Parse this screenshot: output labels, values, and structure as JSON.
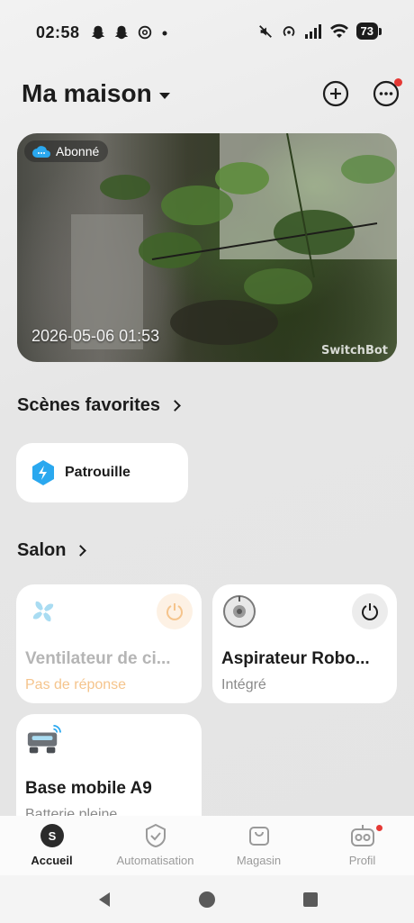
{
  "status_bar": {
    "time": "02:58",
    "battery": "73",
    "left_icons": [
      "snapchat-icon",
      "snapchat-icon",
      "threads-icon",
      "dot-icon"
    ],
    "right_icons": [
      "mute-icon",
      "hotspot-icon",
      "signal-icon",
      "wifi-icon",
      "battery-icon"
    ]
  },
  "header": {
    "title": "Ma maison"
  },
  "camera": {
    "badge": "Abonné",
    "timestamp": "2026-05-06 01:53",
    "watermark": "SwitchBot"
  },
  "favorites": {
    "title": "Scènes favorites",
    "scenes": [
      {
        "label": "Patrouille",
        "icon": "bolt-hexagon-icon"
      }
    ]
  },
  "room": {
    "title": "Salon",
    "devices": [
      {
        "name": "Ventilateur de ci...",
        "status": "Pas de réponse",
        "icon": "fan-icon",
        "has_power": true
      },
      {
        "name": "Aspirateur Robo...",
        "status": "Intégré",
        "icon": "robot-vacuum-icon",
        "has_power": true
      },
      {
        "name": "Base mobile A9",
        "status": "Batterie pleine",
        "icon": "mobile-base-icon",
        "has_power": false
      }
    ]
  },
  "tabs": [
    {
      "label": "Accueil",
      "active": true,
      "icon": "home-avatar-icon"
    },
    {
      "label": "Automatisation",
      "active": false,
      "icon": "shield-check-icon"
    },
    {
      "label": "Magasin",
      "active": false,
      "icon": "shopping-bag-icon"
    },
    {
      "label": "Profil",
      "active": false,
      "icon": "robot-face-icon"
    }
  ],
  "colors": {
    "accent_blue": "#2aa8ef",
    "offline_orange": "#f5c48c",
    "notification_red": "#e53935"
  }
}
